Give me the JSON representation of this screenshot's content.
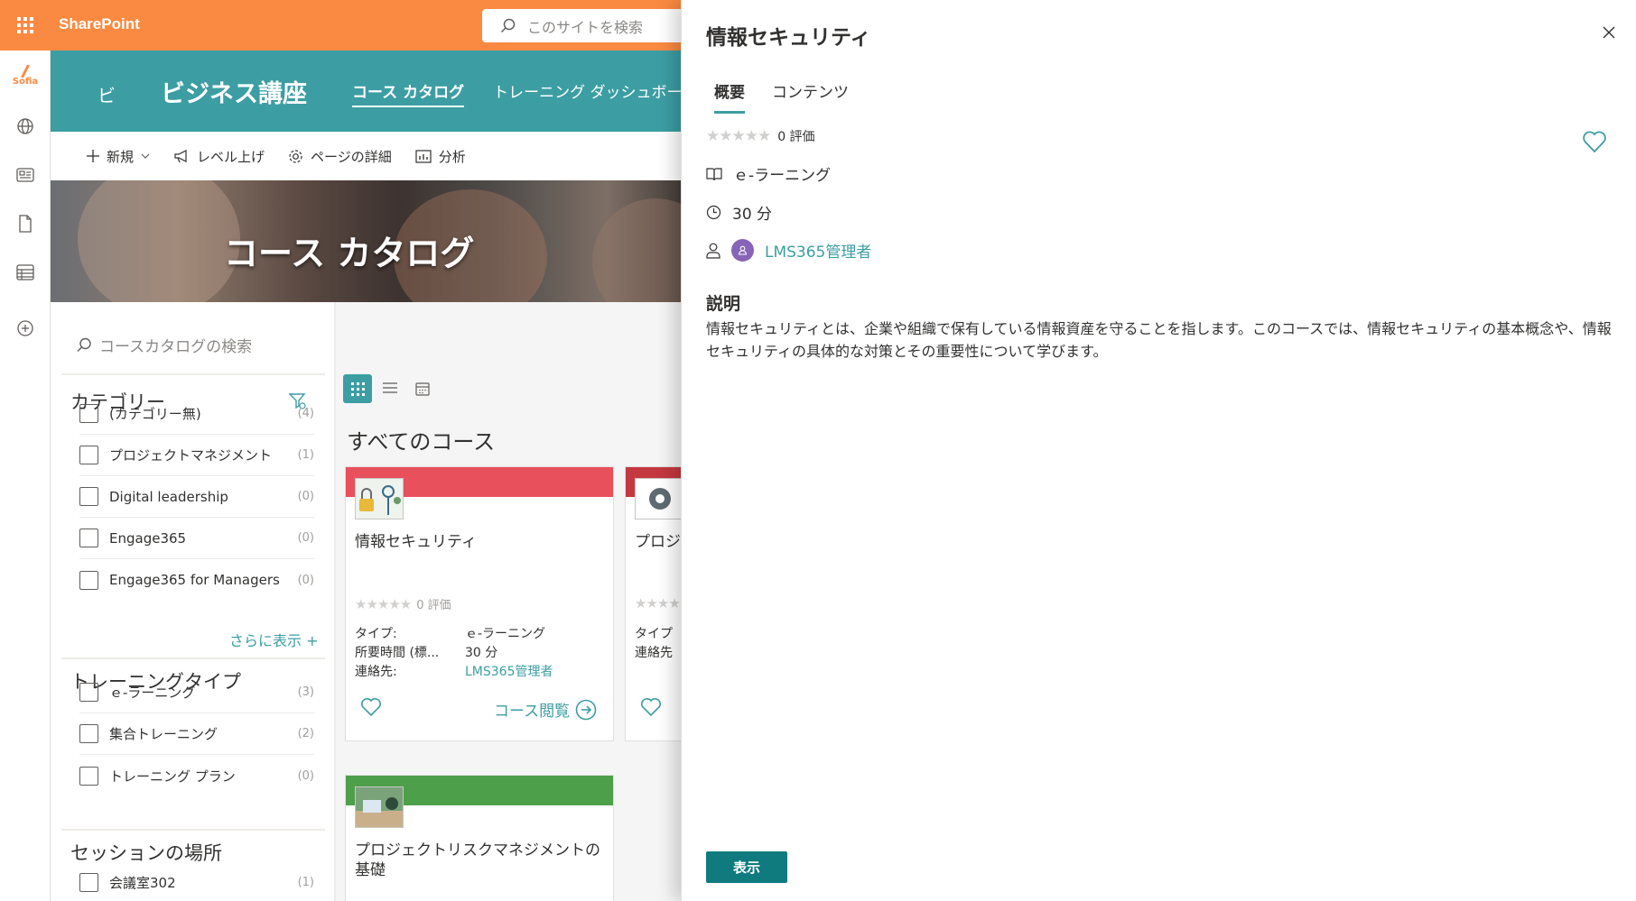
{
  "suite": {
    "brand": "SharePoint",
    "search_placeholder": "このサイトを検索"
  },
  "appbar": {
    "items": [
      "sofia-logo",
      "globe-icon",
      "news-icon",
      "file-icon",
      "list-icon",
      "add-icon"
    ],
    "sofia_label": "Sofia"
  },
  "site": {
    "logo_text": "ビ",
    "title": "ビジネス講座",
    "nav": [
      "コース カタログ",
      "トレーニング ダッシュボード"
    ]
  },
  "commandbar": {
    "new_label": "新規",
    "promote_label": "レベル上げ",
    "page_details_label": "ページの詳細",
    "analytics_label": "分析"
  },
  "hero": {
    "title": "コース カタログ"
  },
  "filter": {
    "search_placeholder": "コースカタログの検索",
    "category_heading": "カテゴリー",
    "categories": [
      {
        "label": "(カテゴリー無)",
        "count": "(4)"
      },
      {
        "label": "プロジェクトマネジメント",
        "count": "(1)"
      },
      {
        "label": "Digital leadership",
        "count": "(0)"
      },
      {
        "label": "Engage365",
        "count": "(0)"
      },
      {
        "label": "Engage365 for Managers",
        "count": "(0)"
      }
    ],
    "show_more": "さらに表示 +",
    "training_type_heading": "トレーニングタイプ",
    "training_types": [
      {
        "label": "ｅ-ラーニング",
        "count": "(3)"
      },
      {
        "label": "集合トレーニング",
        "count": "(2)"
      },
      {
        "label": "トレーニング プラン",
        "count": "(0)"
      }
    ],
    "session_heading": "セッションの場所",
    "sessions": [
      {
        "label": "会議室302",
        "count": "(1)"
      }
    ]
  },
  "main": {
    "heading": "すべてのコース",
    "cards": [
      {
        "title": "情報セキュリティ",
        "rating_count": "0 評価",
        "type_key": "タイプ:",
        "type_val": "ｅ-ラーニング",
        "duration_key": "所要時間 (標...",
        "duration_val": "30 分",
        "contact_key": "連絡先:",
        "contact_val": "LMS365管理者",
        "open_label": "コース閲覧",
        "bar_color": "#e8505b"
      },
      {
        "title": "プロジ",
        "type_key": "タイプ",
        "contact_key": "連絡先",
        "bar_color": "#c4393f"
      },
      {
        "title": "プロジェクトリスクマネジメントの基礎",
        "bar_color": "#4e9f4a"
      }
    ]
  },
  "panel": {
    "title": "情報セキュリティ",
    "tabs": [
      "概要",
      "コンテンツ"
    ],
    "rating_count": "0 評価",
    "type": "ｅ-ラーニング",
    "duration": "30 分",
    "contact": "LMS365管理者",
    "description_heading": "説明",
    "description": "情報セキュリティとは、企業や組織で保有している情報資産を守ることを指します。このコースでは、情報セキュリティの基本概念や、情報セキュリティの具体的な対策とその重要性について学びます。",
    "view_button": "表示"
  },
  "colors": {
    "suite_bar": "#fa8a42",
    "site_header": "#3c9ea3",
    "accent": "#3c9ea3",
    "button": "#0f7b7f",
    "avatar": "#8764b8"
  }
}
